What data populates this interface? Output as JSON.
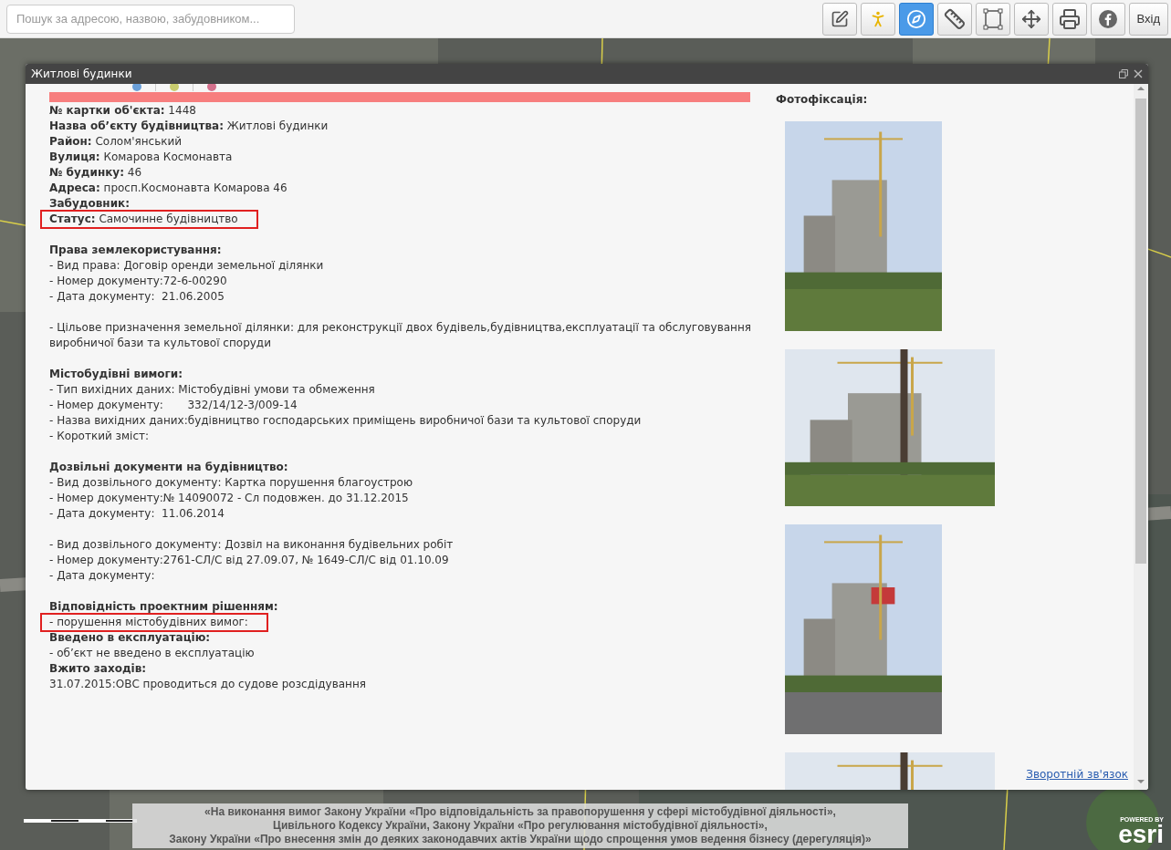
{
  "toolbar": {
    "search": {
      "placeholder": "Пошук за адресою, назвою, забудовником..."
    },
    "tools": [
      {
        "selected": false
      },
      {
        "selected": false
      },
      {
        "selected": true
      },
      {
        "selected": false
      },
      {
        "selected": false
      },
      {
        "selected": false
      },
      {
        "selected": false
      },
      {
        "selected": false
      }
    ],
    "login": "Вхід"
  },
  "dialog": {
    "title": "Житлові будинки",
    "legend": [
      {
        "color": "#6a9fd8"
      },
      {
        "color": "#c9cc6e"
      },
      {
        "color": "#d4708c"
      }
    ],
    "lines": [
      {
        "kind": "field",
        "label": "№ картки об'єкта:",
        "value": "1448",
        "highlighted": false
      },
      {
        "kind": "field",
        "label": "Назва об’єкту будівництва:",
        "value": "Житлові будинки",
        "highlighted": false
      },
      {
        "kind": "field",
        "label": "Район:",
        "value": "Солом'янський",
        "highlighted": false
      },
      {
        "kind": "field",
        "label": "Вулиця:",
        "value": "Комарова Космонавта",
        "highlighted": false
      },
      {
        "kind": "field",
        "label": "№ будинку:",
        "value": "46",
        "highlighted": false
      },
      {
        "kind": "field",
        "label": "Адреса:",
        "value": "просп.Космонавта Комарова 46",
        "highlighted": false
      },
      {
        "kind": "field",
        "label": "Забудовник:",
        "highlighted": false
      },
      {
        "kind": "field",
        "label": "Статус:",
        "value": "Самочинне будівництво",
        "highlighted": true
      },
      {
        "kind": "gap"
      },
      {
        "kind": "heading",
        "text": "Права землекористування:"
      },
      {
        "kind": "text",
        "text": "- Вид права: Договір оренди земельної ділянки",
        "highlighted": false
      },
      {
        "kind": "text",
        "text": "- Номер документу:72-6-00290",
        "highlighted": false
      },
      {
        "kind": "text",
        "text": "- Дата документу:  21.06.2005",
        "highlighted": false
      },
      {
        "kind": "gap"
      },
      {
        "kind": "text",
        "text": "- Цільове призначення земельної ділянки: для реконструкції двох будівель,будівництва,експлуатації та обслуговування виробничої бази та культової споруди",
        "highlighted": false
      },
      {
        "kind": "gap"
      },
      {
        "kind": "heading",
        "text": "Містобудівні вимоги:"
      },
      {
        "kind": "text",
        "text": "- Тип вихідних даних: Містобудівні умови та обмеження",
        "highlighted": false
      },
      {
        "kind": "text",
        "text": "- Номер документу:       332/14/12-3/009-14",
        "highlighted": false
      },
      {
        "kind": "text",
        "text": "- Назва вихідних даних:будівництво господарських приміщень виробничої бази та культової споруди",
        "highlighted": false
      },
      {
        "kind": "text",
        "text": "- Короткий зміст:",
        "highlighted": false
      },
      {
        "kind": "gap"
      },
      {
        "kind": "heading",
        "text": "Дозвільні документи на будівництво:"
      },
      {
        "kind": "text",
        "text": "- Вид дозвільного документу: Картка порушення благоустрою",
        "highlighted": false
      },
      {
        "kind": "text",
        "text": "- Номер документу:№ 14090072 - Сл подовжен. до 31.12.2015",
        "highlighted": false
      },
      {
        "kind": "text",
        "text": "- Дата документу:  11.06.2014",
        "highlighted": false
      },
      {
        "kind": "gap"
      },
      {
        "kind": "text",
        "text": "- Вид дозвільного документу: Дозвіл на виконання будівельних робіт",
        "highlighted": false
      },
      {
        "kind": "text",
        "text": "- Номер документу:2761-СЛ/С від 27.09.07, № 1649-СЛ/С від 01.10.09",
        "highlighted": false
      },
      {
        "kind": "text",
        "text": "- Дата документу:",
        "highlighted": false
      },
      {
        "kind": "gap"
      },
      {
        "kind": "heading",
        "text": "Відповідність проектним рішенням:"
      },
      {
        "kind": "text",
        "text": "- порушення містобудівних вимог:",
        "highlighted": true
      },
      {
        "kind": "heading",
        "text": "Введено в експлуатацію:"
      },
      {
        "kind": "text",
        "text": "- об’єкт не введено в експлуатацію",
        "highlighted": false
      },
      {
        "kind": "heading",
        "text": "Вжито заходів:"
      },
      {
        "kind": "text",
        "text": "31.07.2015:ОВС проводиться до судове розсдідування",
        "highlighted": false
      }
    ],
    "photos_title": "Фотофіксація:",
    "feedback_link": "Зворотній зв'язок"
  },
  "footer": {
    "notice": [
      "«На виконання вимог Закону України «Про відповідальність за правопорушення у сфері містобудівної діяльності»,",
      "Цивільного Кодексу України, Закону України «Про регулювання містобудівної діяльності»,",
      "Закону України «Про внесення змін до деяких законодавчих актів України щодо спрощення умов ведення бізнесу (дерегуляція)»"
    ],
    "powered_by": "POWERED BY",
    "brand": "esri"
  }
}
